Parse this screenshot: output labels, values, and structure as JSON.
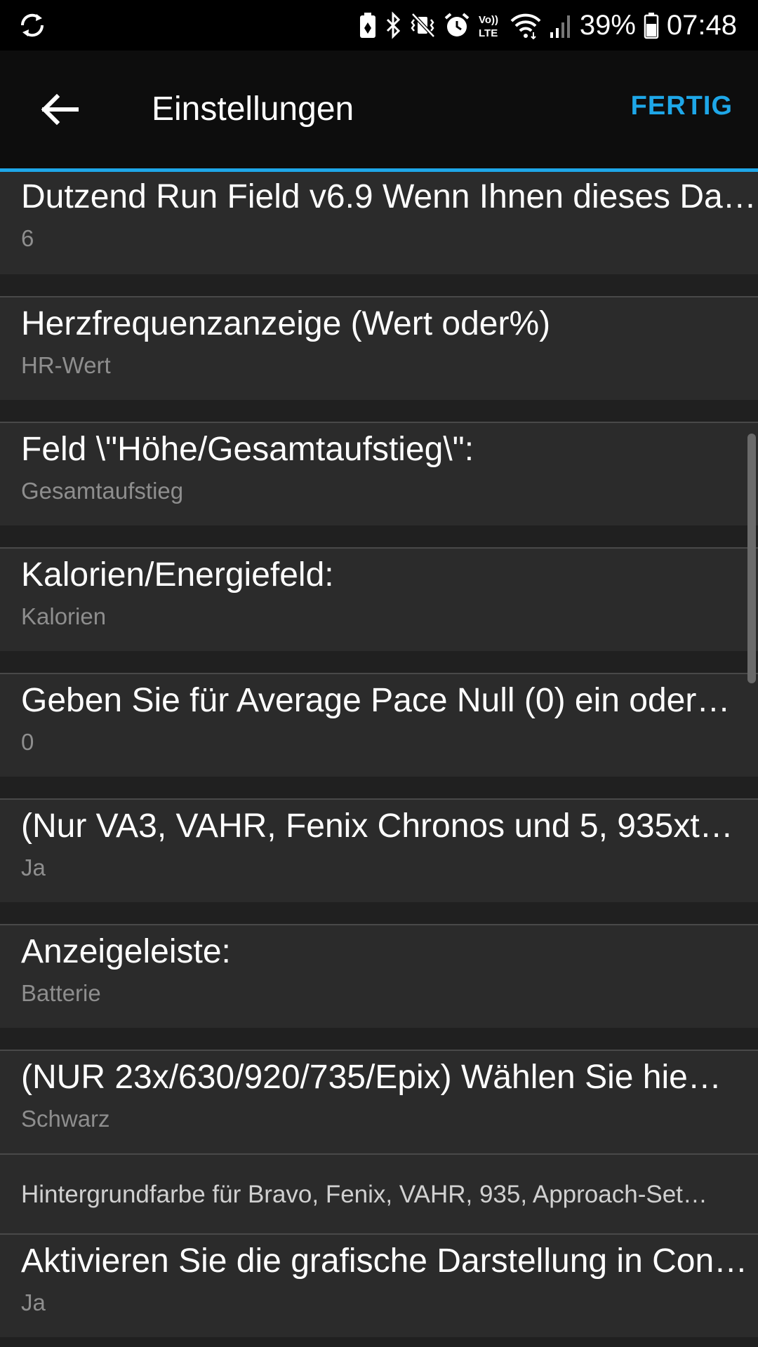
{
  "status_bar": {
    "battery_percent": "39%",
    "time": "07:48",
    "icons": [
      "sync-icon",
      "battery-saver-icon",
      "bluetooth-icon",
      "vibrate-mute-icon",
      "alarm-icon",
      "volte-icon",
      "wifi-icon",
      "signal-icon",
      "battery-icon"
    ]
  },
  "header": {
    "title": "Einstellungen",
    "done_label": "FERTIG",
    "back_icon": "arrow-left-icon",
    "accent_color": "#1ea7e8"
  },
  "settings": [
    {
      "title": "Dutzend Run Field v6.9 Wenn Ihnen dieses Da…",
      "value": "6"
    },
    {
      "title": "Herzfrequenzanzeige (Wert oder%)",
      "value": "HR-Wert"
    },
    {
      "title": "Feld \\\"Höhe/Gesamtaufstieg\\\":",
      "value": "Gesamtaufstieg"
    },
    {
      "title": "Kalorien/Energiefeld:",
      "value": "Kalorien"
    },
    {
      "title": "Geben Sie für Average Pace Null (0) ein oder…",
      "value": "0"
    },
    {
      "title": " (Nur VA3, VAHR, Fenix Chronos und 5, 935xt…",
      "value": "Ja"
    },
    {
      "title": "Anzeigeleiste:",
      "value": "Batterie"
    },
    {
      "title": "(NUR 23x/630/920/735/Epix)  Wählen Sie hie…",
      "value": "Schwarz"
    },
    {
      "title": "Hintergrundfarbe für Bravo, Fenix, VAHR, 935, Approach-Set…"
    },
    {
      "title": "Aktivieren Sie die grafische Darstellung in Con…",
      "value": "Ja"
    }
  ]
}
